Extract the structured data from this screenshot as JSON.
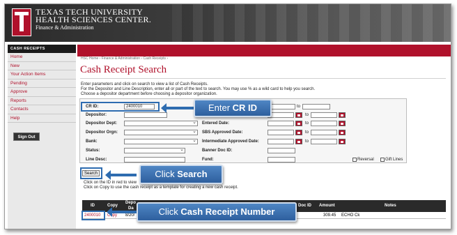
{
  "header": {
    "line1": "TEXAS TECH UNIVERSITY",
    "line2": "HEALTH SCIENCES CENTER.",
    "line3": "Finance & Administration"
  },
  "sidebar": {
    "heading": "CASH RECEIPTS",
    "items": [
      {
        "label": "Home"
      },
      {
        "label": "New"
      },
      {
        "label": "Your Action Items"
      },
      {
        "label": "Pending"
      },
      {
        "label": "Approve"
      },
      {
        "label": "Reports"
      },
      {
        "label": "Contacts"
      },
      {
        "label": "Help"
      }
    ],
    "signout_label": "Sign Out"
  },
  "page": {
    "breadcrumb": "HSC Home  ›  Finance & Administration  ›  Cash Receipts  ›",
    "title": "Cash Receipt Search",
    "instructions": [
      "Enter parameters and click on search to view a list of Cash Receipts.",
      "For the Depositor and Line Description, enter all or part of the text to search. You may use % as a wild card to help you search.",
      "Choose a depositor department before choosing a depositor organization."
    ]
  },
  "form": {
    "cr_id_label": "CR ID:",
    "cr_id_value": "2400010",
    "depositor_label": "Depositor:",
    "depositor_dept_label": "Depositor Dept:",
    "depositor_orgn_label": "Depositor Orgn:",
    "bank_label": "Bank:",
    "status_label": "Status:",
    "line_desc_label": "Line Desc:",
    "entered_date_label": "Entered Date:",
    "sbs_date_label": "SBS Approved Date:",
    "intermediate_date_label": "Intermediate Approved Date:",
    "banner_doc_label": "Banner Doc ID:",
    "fund_label": "Fund:",
    "to_label": "to",
    "reversal_label": "Reversal",
    "gift_lines_label": "Gift Lines",
    "search_label": "Search"
  },
  "results": {
    "hint1": "Click on the ID in red to view",
    "hint2": "Click on Copy to use the cash receipt as a template for creating a new cash receipt.",
    "columns": {
      "id": "ID",
      "copy": "Copy",
      "deposit": "Depo",
      "deposit2": "Da",
      "doc_id": "Doc ID",
      "amount": "Amount",
      "notes": "Notes"
    },
    "rows": [
      {
        "id": "2400010",
        "copy": "Copy",
        "date": "8/20/",
        "amount": "309.45",
        "notes": "ECHO Ck"
      }
    ]
  },
  "callouts": {
    "cr_id_prefix": "Enter ",
    "cr_id_bold": "CR ID",
    "search_prefix": "Click ",
    "search_bold": "Search",
    "number_prefix": "Click ",
    "number_bold": "Cash Receipt Number"
  },
  "colors": {
    "brand_red": "#b0112b",
    "callout_blue": "#2e6cb0"
  }
}
